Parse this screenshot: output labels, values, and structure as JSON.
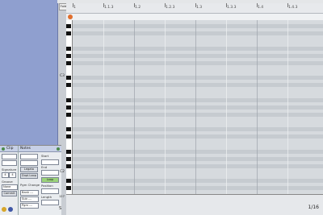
{
  "clip_panel": {
    "title": "Clip",
    "signature_label": "Signature",
    "signature_num": "4",
    "signature_den": "4",
    "groove_label": "Groove",
    "groove_value": "None",
    "commit_label": "Commit"
  },
  "notes_panel": {
    "title": "Notes",
    "start_label": "Start",
    "end_label": "End",
    "legato_label": "Legato",
    "dupl_loop_label": "Dupl.Loop",
    "loop_label": "Loop",
    "pgm_change_label": "Pgm Change",
    "position_label": "Position",
    "bank_label": "Bank ---",
    "length_label": "Length",
    "sub_label": "Sub ---",
    "pgm_label": "Pgm ---"
  },
  "ruler": {
    "fold_label": "Fold",
    "ticks": [
      "1",
      "1.1.3",
      "1.2",
      "1.2.3",
      "1.3",
      "1.3.3",
      "1.4",
      "1.4.3"
    ]
  },
  "keyboard": {
    "octave_labels": [
      "C3",
      "C2"
    ]
  },
  "velocity": {
    "header_label": "127",
    "fold_label": "S"
  },
  "status": {
    "quantize": "1/16"
  },
  "colors": {
    "gutter": "#8f9fcf",
    "grid_light": "#d6dade",
    "grid_dark": "#c6cbd0",
    "loop_marker": "#e06f2f",
    "loop_button": "#9bd37a"
  }
}
